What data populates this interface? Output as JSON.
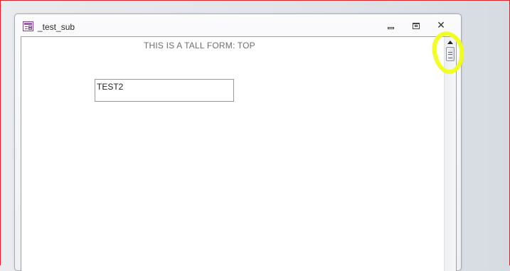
{
  "window": {
    "title": "_test_sub",
    "title_icon": "form-icon",
    "controls": {
      "minimize_icon": "minimize-icon",
      "restore_icon": "restore-icon",
      "close_glyph": "✕"
    }
  },
  "form": {
    "heading": "THIS IS A TALL FORM: TOP",
    "text_box_value": "TEST2"
  },
  "scrollbar": {
    "up_arrow_icon": "arrow-up-icon",
    "thumb_position": 0
  },
  "annotation": {
    "highlight_color": "#f0ff1a",
    "frame_color": "#d9242c"
  }
}
